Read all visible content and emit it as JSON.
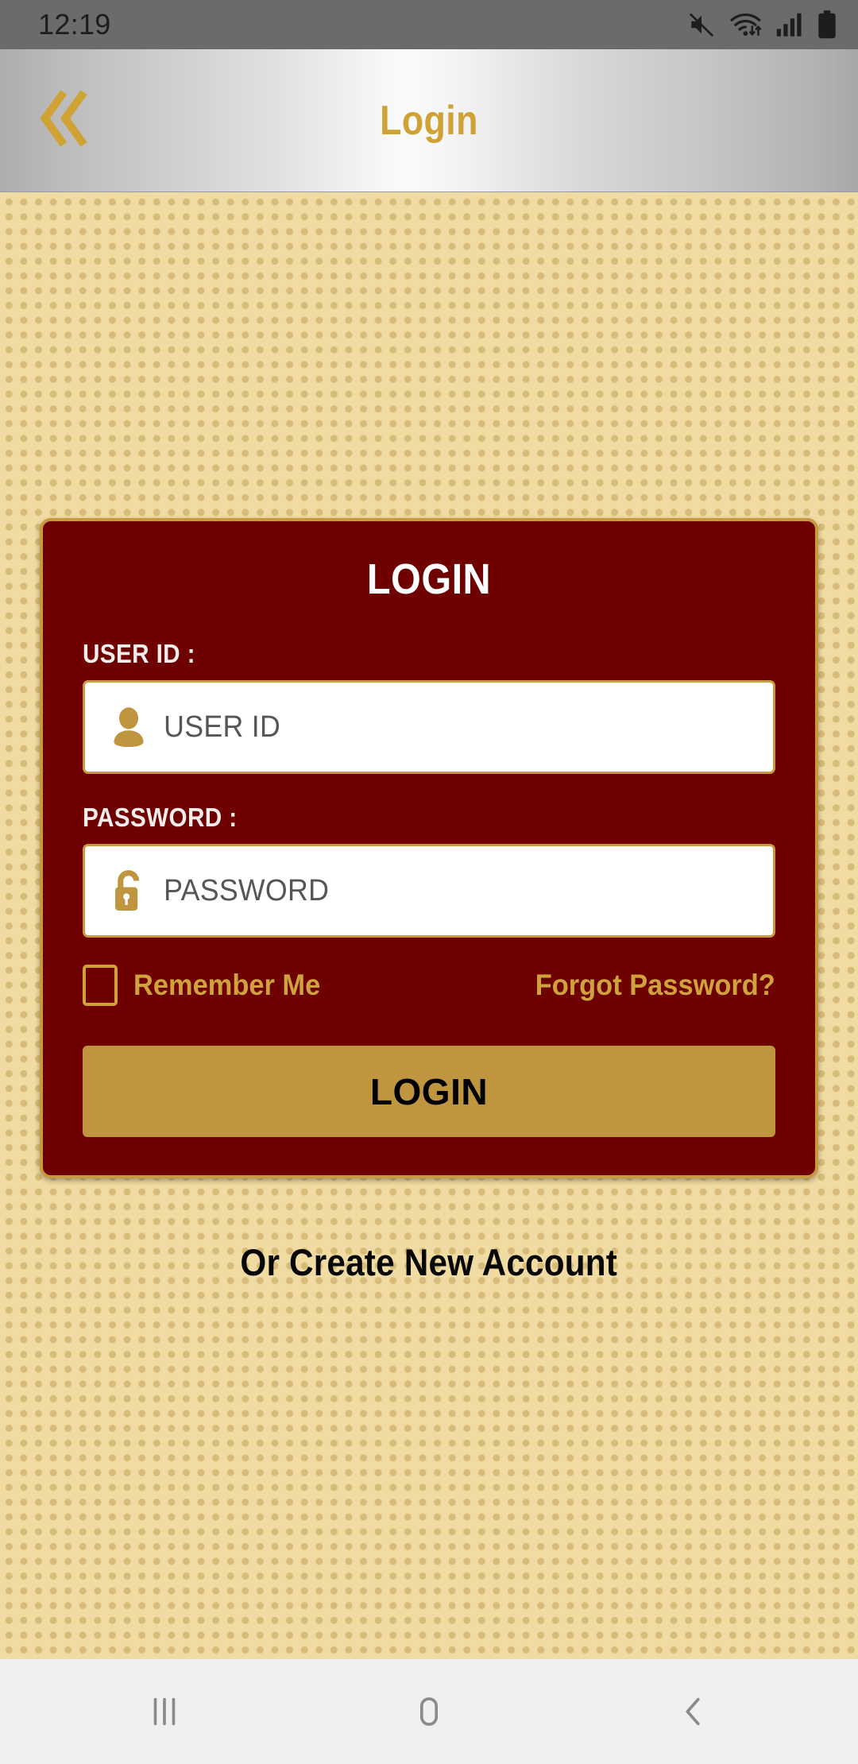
{
  "status_bar": {
    "clock": "12:19",
    "icons": [
      {
        "name": "sound-off-icon",
        "label": "mute"
      },
      {
        "name": "wifi-data-icon",
        "label": "wifi with data transfer"
      },
      {
        "name": "cellular-signal-icon",
        "label": "signal bars"
      },
      {
        "name": "battery-icon",
        "label": "battery full"
      }
    ]
  },
  "header": {
    "title": "Login",
    "back_icon": "double-chevron-left-icon",
    "title_color": "#CFA233"
  },
  "card": {
    "title": "LOGIN",
    "background_color": "#6E0000",
    "border_color": "#C79A3F",
    "fields": [
      {
        "label": "USER ID :",
        "placeholder": "USER ID",
        "value": "",
        "icon": "user-icon",
        "type": "text"
      },
      {
        "label": "PASSWORD :",
        "placeholder": "PASSWORD",
        "value": "",
        "icon": "unlocked-padlock-icon",
        "type": "password"
      }
    ],
    "remember_me": {
      "label": "Remember Me",
      "checked": false
    },
    "forgot_password": "Forgot Password?",
    "login_button": "LOGIN",
    "accent_color": "#C09540",
    "gold_text_color": "#CFA23E"
  },
  "create_account": "Or Create New Account",
  "background": {
    "base_color": "#F0DBA3",
    "dot_color": "#D6BC78"
  },
  "nav_bar": {
    "buttons": [
      {
        "name": "recents-button",
        "icon": "recents-icon"
      },
      {
        "name": "home-button",
        "icon": "home-icon"
      },
      {
        "name": "back-button",
        "icon": "chevron-left-icon"
      }
    ]
  }
}
